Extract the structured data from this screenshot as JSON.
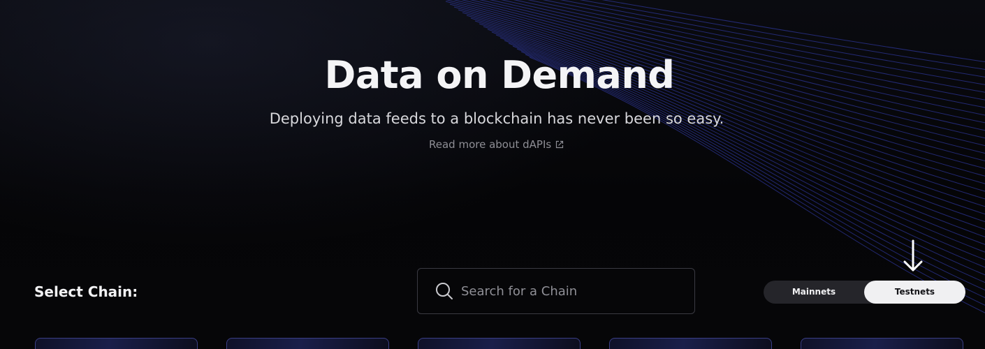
{
  "hero": {
    "title": "Data on Demand",
    "subtitle": "Deploying data feeds to a blockchain has never been so easy.",
    "read_more_label": "Read more about dAPIs",
    "read_more_icon": "external-link-icon"
  },
  "chain_selector": {
    "label": "Select Chain:",
    "search": {
      "placeholder": "Search for a Chain",
      "value": "",
      "icon": "search-icon"
    },
    "network_toggle": {
      "options": [
        "Mainnets",
        "Testnets"
      ],
      "selected": "Testnets",
      "indicator_icon": "arrow-down-icon"
    }
  },
  "colors": {
    "background": "#050507",
    "accent_lines": "#3a45c8",
    "card_border": "#3b3f86",
    "toggle_selected_bg": "#f0f0f2",
    "toggle_bg": "#25252a"
  }
}
